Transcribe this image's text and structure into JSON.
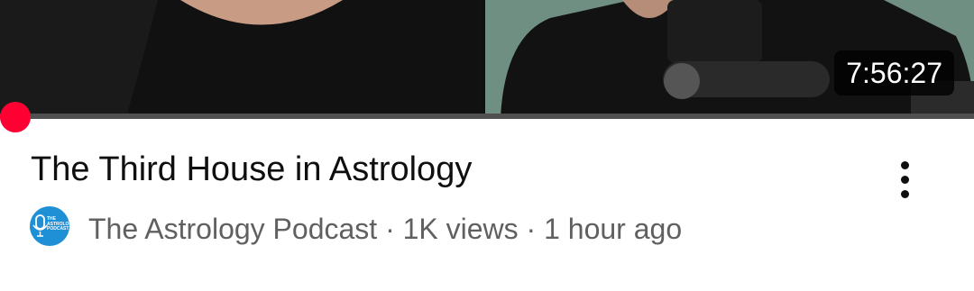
{
  "video": {
    "duration": "7:56:27",
    "progress_percent": 0,
    "title": "The Third House in Astrology",
    "channel": "The Astrology Podcast",
    "views": "1K views",
    "age": "1 hour ago",
    "separator": "·",
    "avatar_text": "THE\nASTROLOGY\nPODCAST"
  },
  "colors": {
    "progress": "#ff0033",
    "title_text": "#0f0f0f",
    "meta_text": "#606060",
    "avatar_bg": "#1f8fd6"
  },
  "icons": {
    "menu": "kebab-vertical-icon"
  }
}
